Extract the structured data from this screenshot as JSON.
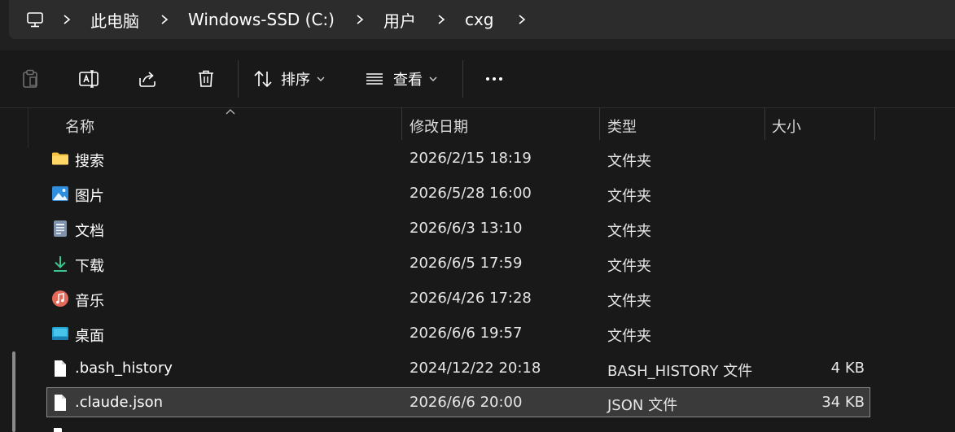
{
  "breadcrumb": {
    "items": [
      "此电脑",
      "Windows-SSD (C:)",
      "用户",
      "cxg"
    ]
  },
  "toolbar": {
    "sort_label": "排序",
    "view_label": "查看"
  },
  "columns": {
    "name": "名称",
    "modified": "修改日期",
    "type": "类型",
    "size": "大小"
  },
  "files": [
    {
      "name": "搜索",
      "modified": "2026/2/15 18:19",
      "type": "文件夹",
      "size": "",
      "icon": "search-folder-icon"
    },
    {
      "name": "图片",
      "modified": "2026/5/28 16:00",
      "type": "文件夹",
      "size": "",
      "icon": "pictures-folder-icon"
    },
    {
      "name": "文档",
      "modified": "2026/6/3 13:10",
      "type": "文件夹",
      "size": "",
      "icon": "documents-folder-icon"
    },
    {
      "name": "下载",
      "modified": "2026/6/5 17:59",
      "type": "文件夹",
      "size": "",
      "icon": "downloads-folder-icon"
    },
    {
      "name": "音乐",
      "modified": "2026/4/26 17:28",
      "type": "文件夹",
      "size": "",
      "icon": "music-folder-icon"
    },
    {
      "name": "桌面",
      "modified": "2026/6/6 19:57",
      "type": "文件夹",
      "size": "",
      "icon": "desktop-folder-icon"
    },
    {
      "name": ".bash_history",
      "modified": "2024/12/22 20:18",
      "type": "BASH_HISTORY 文件",
      "size": "4 KB",
      "icon": "file-icon"
    },
    {
      "name": ".claude.json",
      "modified": "2026/6/6 20:00",
      "type": "JSON 文件",
      "size": "34 KB",
      "icon": "file-icon",
      "selected": true
    }
  ],
  "colors": {
    "background": "#191919",
    "breadcrumb_bg": "#2c2c2c",
    "selection_bg": "#3a3a3a",
    "folder_yellow": "#f5c242",
    "download_green": "#3cc58e"
  }
}
